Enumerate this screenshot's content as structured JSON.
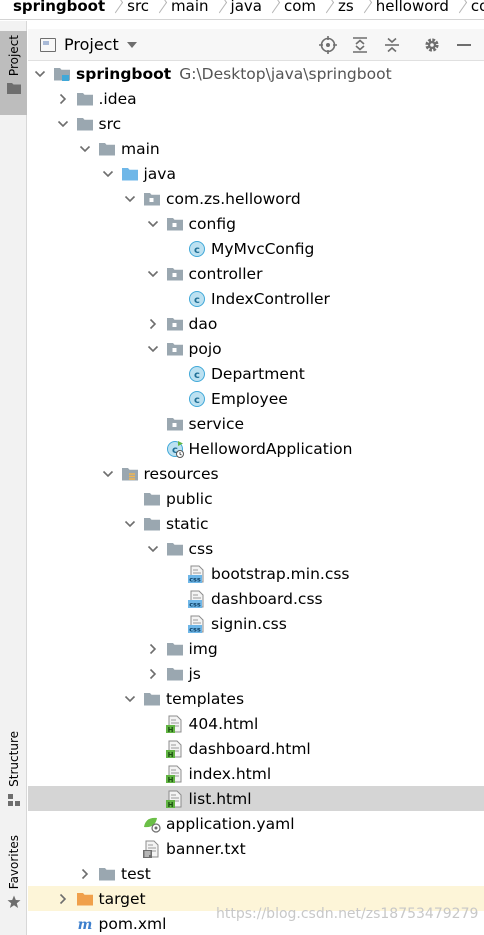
{
  "breadcrumb": [
    "springboot",
    "src",
    "main",
    "java",
    "com",
    "zs",
    "helloword",
    "confi"
  ],
  "left_strip": {
    "project_label": "Project",
    "structure_label": "Structure",
    "favorites_label": "Favorites"
  },
  "header": {
    "title": "Project",
    "icons": [
      "locate-icon",
      "expand-all-icon",
      "collapse-all-icon",
      "settings-icon",
      "minimize-icon"
    ]
  },
  "tree": [
    {
      "label": "springboot",
      "path": "G:\\Desktop\\java\\springboot",
      "depth": 0,
      "type": "module",
      "expanded": true
    },
    {
      "label": ".idea",
      "depth": 1,
      "type": "folder",
      "expanded": false
    },
    {
      "label": "src",
      "depth": 1,
      "type": "folder",
      "expanded": true
    },
    {
      "label": "main",
      "depth": 2,
      "type": "folder",
      "expanded": true
    },
    {
      "label": "java",
      "depth": 3,
      "type": "source-folder",
      "expanded": true
    },
    {
      "label": "com.zs.helloword",
      "depth": 4,
      "type": "package",
      "expanded": true
    },
    {
      "label": "config",
      "depth": 5,
      "type": "package",
      "expanded": true
    },
    {
      "label": "MyMvcConfig",
      "depth": 6,
      "type": "class"
    },
    {
      "label": "controller",
      "depth": 5,
      "type": "package",
      "expanded": true
    },
    {
      "label": "IndexController",
      "depth": 6,
      "type": "class"
    },
    {
      "label": "dao",
      "depth": 5,
      "type": "package",
      "expanded": false
    },
    {
      "label": "pojo",
      "depth": 5,
      "type": "package",
      "expanded": true
    },
    {
      "label": "Department",
      "depth": 6,
      "type": "class"
    },
    {
      "label": "Employee",
      "depth": 6,
      "type": "class"
    },
    {
      "label": "service",
      "depth": 5,
      "type": "package"
    },
    {
      "label": "HellowordApplication",
      "depth": 5,
      "type": "spring-class"
    },
    {
      "label": "resources",
      "depth": 3,
      "type": "resources-folder",
      "expanded": true
    },
    {
      "label": "public",
      "depth": 4,
      "type": "folder"
    },
    {
      "label": "static",
      "depth": 4,
      "type": "folder",
      "expanded": true
    },
    {
      "label": "css",
      "depth": 5,
      "type": "folder",
      "expanded": true
    },
    {
      "label": "bootstrap.min.css",
      "depth": 6,
      "type": "css"
    },
    {
      "label": "dashboard.css",
      "depth": 6,
      "type": "css"
    },
    {
      "label": "signin.css",
      "depth": 6,
      "type": "css"
    },
    {
      "label": "img",
      "depth": 5,
      "type": "folder",
      "expanded": false
    },
    {
      "label": "js",
      "depth": 5,
      "type": "folder",
      "expanded": false
    },
    {
      "label": "templates",
      "depth": 4,
      "type": "folder",
      "expanded": true
    },
    {
      "label": "404.html",
      "depth": 5,
      "type": "html"
    },
    {
      "label": "dashboard.html",
      "depth": 5,
      "type": "html"
    },
    {
      "label": "index.html",
      "depth": 5,
      "type": "html"
    },
    {
      "label": "list.html",
      "depth": 5,
      "type": "html",
      "selected": true
    },
    {
      "label": "application.yaml",
      "depth": 4,
      "type": "yaml"
    },
    {
      "label": "banner.txt",
      "depth": 4,
      "type": "text"
    },
    {
      "label": "test",
      "depth": 2,
      "type": "folder",
      "expanded": false
    },
    {
      "label": "target",
      "depth": 1,
      "type": "excluded-folder",
      "expanded": false
    },
    {
      "label": "pom.xml",
      "depth": 1,
      "type": "maven"
    }
  ],
  "watermark": "https://blog.csdn.net/zs18753479279",
  "colors": {
    "selection": "#d5d5d5",
    "folder": "#9aa7b0",
    "source_folder": "#6fb7e8",
    "target_folder": "#f0a04b",
    "class_icon": "#40a8d8",
    "html_icon": "#62b543"
  }
}
